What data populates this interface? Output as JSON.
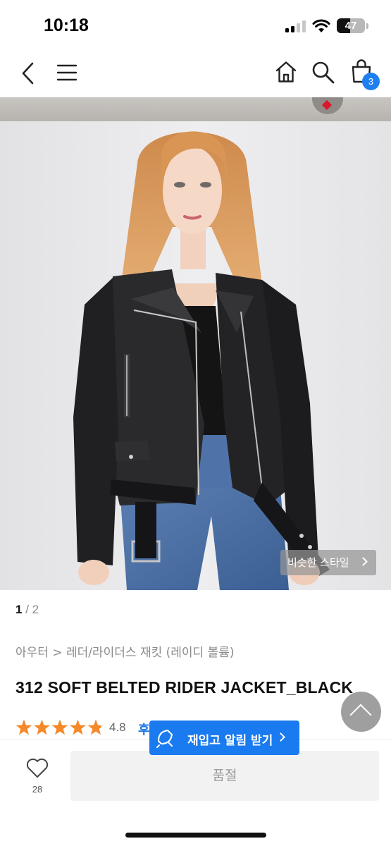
{
  "status_bar": {
    "time": "10:18",
    "battery": "47",
    "battery_level": 0.47
  },
  "nav": {
    "icons": [
      "back-icon",
      "menu-icon",
      "home-icon",
      "search-icon",
      "cart-icon"
    ],
    "cart_count": "3"
  },
  "gallery": {
    "similar_style_label": "비슷한 스타일",
    "current_page": "1",
    "page_separator": " / ",
    "total_pages": "2"
  },
  "product": {
    "breadcrumb": "아우터 > 레더/라이더스 재킷 (레이디 볼륨)",
    "title": "312 SOFT BELTED RIDER JACKET_BLACK",
    "rating": "4.8",
    "rating_stars": 4.8,
    "review_label": "후"
  },
  "restock": {
    "label": "재입고 알림 받기"
  },
  "bottom_bar": {
    "wish_count": "28",
    "soldout_label": "품절"
  },
  "colors": {
    "accent_blue": "#1a7bf0",
    "star_orange": "#f5892a"
  }
}
